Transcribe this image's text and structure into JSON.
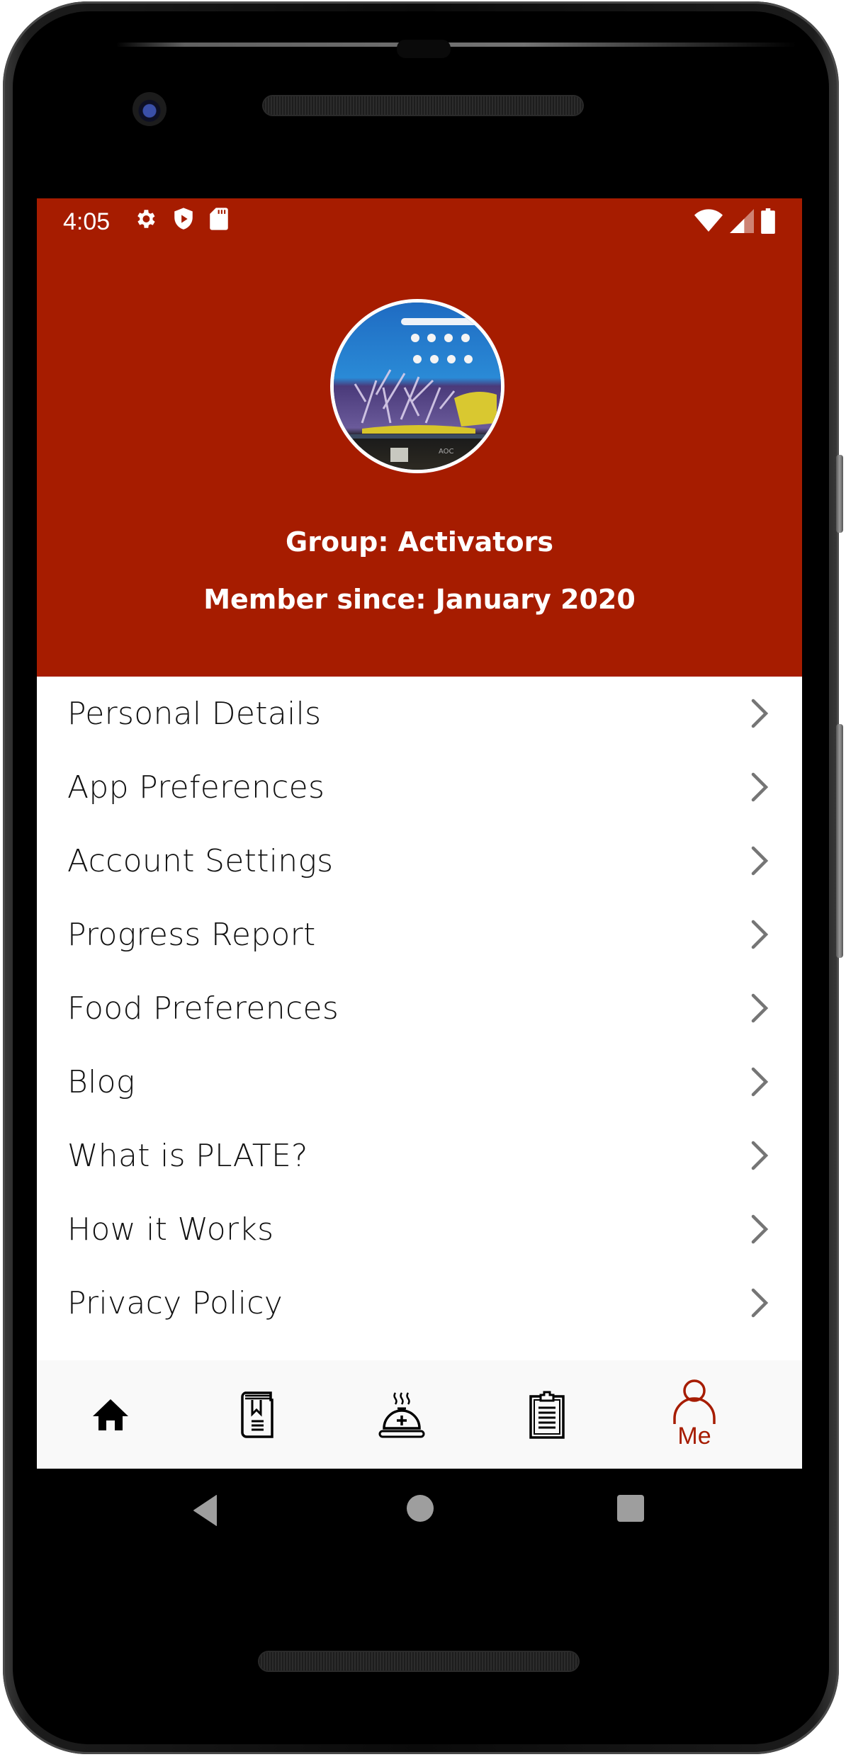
{
  "status_bar": {
    "time": "4:05",
    "left_icons": [
      "gear-icon",
      "shield-play-icon",
      "sd-card-icon"
    ],
    "right_icons": [
      "wifi-icon",
      "cellular-signal-icon",
      "battery-icon"
    ]
  },
  "profile": {
    "avatar_alt": "Profile photo",
    "group_text": "Group: Activators",
    "member_since_text": "Member since: January 2020"
  },
  "menu": {
    "items": [
      {
        "label": "Personal Details"
      },
      {
        "label": "App Preferences"
      },
      {
        "label": "Account Settings"
      },
      {
        "label": "Progress Report"
      },
      {
        "label": "Food Preferences"
      },
      {
        "label": "Blog"
      },
      {
        "label": "What is PLATE?"
      },
      {
        "label": "How it Works"
      },
      {
        "label": "Privacy Policy"
      }
    ]
  },
  "bottom_nav": {
    "items": [
      {
        "icon": "home-icon",
        "label": ""
      },
      {
        "icon": "recipe-book-icon",
        "label": ""
      },
      {
        "icon": "meal-cloche-icon",
        "label": ""
      },
      {
        "icon": "clipboard-icon",
        "label": ""
      },
      {
        "icon": "person-icon",
        "label": "Me",
        "active": true
      }
    ]
  },
  "colors": {
    "brand": "#a61c00",
    "chevron": "#757575",
    "nav_background": "#f9f9f9",
    "system_button": "#9e9e9e"
  },
  "system_nav": {
    "buttons": [
      "back-icon",
      "home-circle-icon",
      "recents-icon"
    ]
  }
}
